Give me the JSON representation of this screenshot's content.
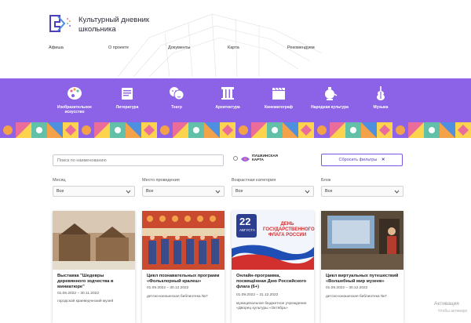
{
  "header": {
    "title": "Культурный дневник школьника",
    "nav": [
      "Афиша",
      "О проекте",
      "Документы",
      "Карта",
      "Рекомендуем"
    ]
  },
  "categories": [
    {
      "label": "Изобразительное искусство",
      "icon": "palette-icon"
    },
    {
      "label": "Литература",
      "icon": "book-icon"
    },
    {
      "label": "Театр",
      "icon": "theatre-masks-icon"
    },
    {
      "label": "Архитектура",
      "icon": "column-icon"
    },
    {
      "label": "Кинематограф",
      "icon": "clapperboard-icon"
    },
    {
      "label": "Народная культура",
      "icon": "samovar-icon"
    },
    {
      "label": "Музыка",
      "icon": "violin-icon"
    }
  ],
  "filters": {
    "search_placeholder": "Поиск по наименованию",
    "pushkin_card": "ПУШКИНСКАЯ КАРТА",
    "reset_label": "Сбросить фильтры",
    "fields": [
      {
        "label": "Месяц",
        "value": "Все"
      },
      {
        "label": "Место проведения",
        "value": "Все"
      },
      {
        "label": "Возрастная категория",
        "value": "Все"
      },
      {
        "label": "Блок",
        "value": "Все"
      }
    ]
  },
  "cards": [
    {
      "title": "Выставка \"Шедевры деревянного зодчества в миниатюре\"",
      "date": "01.06.2022 – 30.11.2022",
      "place": "городской краеведческий музей"
    },
    {
      "title": "Цикл познавательных программ «Фольклорный кралеш»",
      "date": "01.09.2022 – 30.12.2022",
      "place": "детско-юношеская библиотека №7"
    },
    {
      "title": "Онлайн-программа, посвящённая Дню Российского флага (6+)",
      "date": "01.09.2022 – 31.12.2022",
      "place": "муниципальное бюджетное учреждение «Дворец культуры «Октябрь»",
      "image_text_1": "22",
      "image_text_2": "АВГУСТА",
      "image_text_3": "ДЕНЬ ГОСУДАРСТВЕННОГО ФЛАГА РОССИИ"
    },
    {
      "title": "Цикл виртуальных путешествий «Волшебный мир музеев»",
      "date": "01.09.2022 – 30.12.2022",
      "place": "детско-юношеская библиотека №7"
    }
  ],
  "watermark": {
    "line1": "Активация",
    "line2": "Чтобы активиро"
  },
  "colors": {
    "accent": "#8c63e6",
    "accent_dark": "#5b3cc4",
    "strip": "#f4a24a"
  }
}
